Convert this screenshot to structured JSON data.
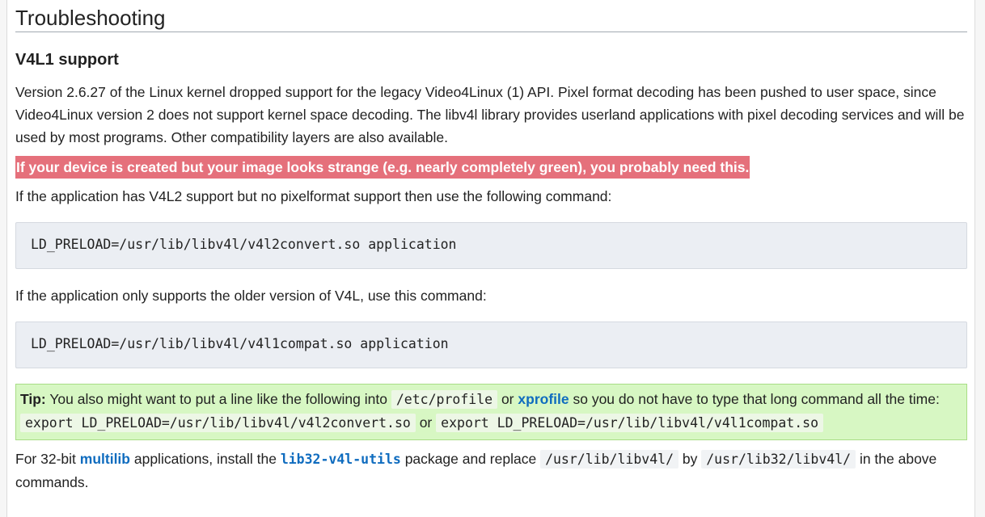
{
  "heading": "Troubleshooting",
  "subheading": "V4L1 support",
  "intro": "Version 2.6.27 of the Linux kernel dropped support for the legacy Video4Linux (1) API. Pixel format decoding has been pushed to user space, since Video4Linux version 2 does not support kernel space decoding. The libv4l library provides userland applications with pixel decoding services and will be used by most programs. Other compatibility layers are also available.",
  "warning": "If your device is created but your image looks strange (e.g. nearly completely green), you probably need this.",
  "para_v4l2": "If the application has V4L2 support but no pixelformat support then use the following command:",
  "code_v4l2": "LD_PRELOAD=/usr/lib/libv4l/v4l2convert.so application",
  "para_v4l1": "If the application only supports the older version of V4L, use this command:",
  "code_v4l1": "LD_PRELOAD=/usr/lib/libv4l/v4l1compat.so application",
  "tip": {
    "label": "Tip:",
    "text1": "You also might want to put a line like the following into",
    "code_profile": "/etc/profile",
    "or1": "or",
    "link_xprofile": "xprofile",
    "text2": "so you do not have to type that long command all the time:",
    "code_export1": "export LD_PRELOAD=/usr/lib/libv4l/v4l2convert.so",
    "or2": "or",
    "code_export2": "export LD_PRELOAD=/usr/lib/libv4l/v4l1compat.so"
  },
  "final": {
    "text1": "For 32-bit",
    "link_multilib": "multilib",
    "text2": "applications, install the",
    "link_pkg": "lib32-v4l-utils",
    "text3": "package and replace",
    "code_a": "/usr/lib/libv4l/",
    "by": "by",
    "code_b": "/usr/lib32/libv4l/",
    "text4": "in the above commands."
  }
}
